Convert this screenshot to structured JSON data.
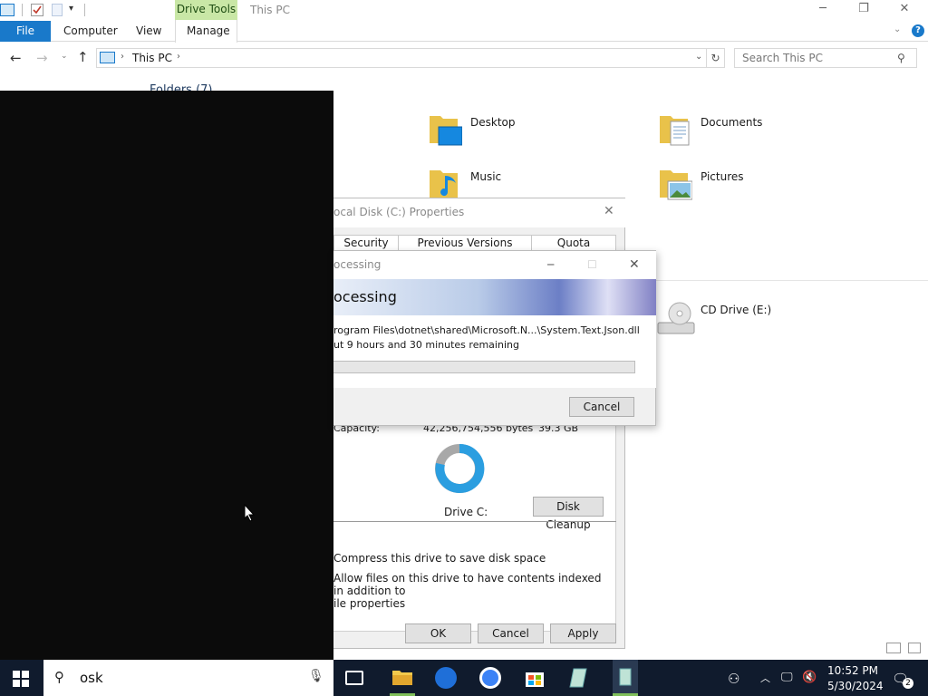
{
  "window": {
    "title": "This PC",
    "context_tab": "Drive Tools"
  },
  "ribbon": {
    "tabs": [
      "File",
      "Computer",
      "View",
      "Manage"
    ]
  },
  "address": {
    "path": "This PC",
    "search_placeholder": "Search This PC"
  },
  "content": {
    "section_header": "Folders (7)",
    "folders": [
      "Desktop",
      "Documents",
      "Music",
      "Pictures"
    ],
    "devices": [
      "CD Drive (E:)"
    ]
  },
  "properties_dialog": {
    "title": "ocal Disk (C:) Properties",
    "tabs": [
      "Security",
      "Previous Versions",
      "Quota"
    ],
    "capacity_label": "Capacity:",
    "capacity_bytes": "42,256,754,556 bytes",
    "capacity_gb": "39.3 GB",
    "drive_label": "Drive C:",
    "disk_cleanup": "Disk Cleanup",
    "compress": "Compress this drive to save disk space",
    "index_line1": "Allow files on this drive to have contents indexed in addition to",
    "index_line2": "ile properties",
    "ok": "OK",
    "cancel": "Cancel",
    "apply": "Apply"
  },
  "processing_dialog": {
    "title": "ocessing",
    "heading": "ocessing",
    "file": "rogram Files\\dotnet\\shared\\Microsoft.N...\\System.Text.Json.dll",
    "remaining": "ut 9 hours and 30 minutes remaining",
    "cancel": "Cancel",
    "progress": 0.0
  },
  "taskbar": {
    "search_value": "osk",
    "time": "10:52 PM",
    "date": "5/30/2024",
    "notifications": "2"
  }
}
